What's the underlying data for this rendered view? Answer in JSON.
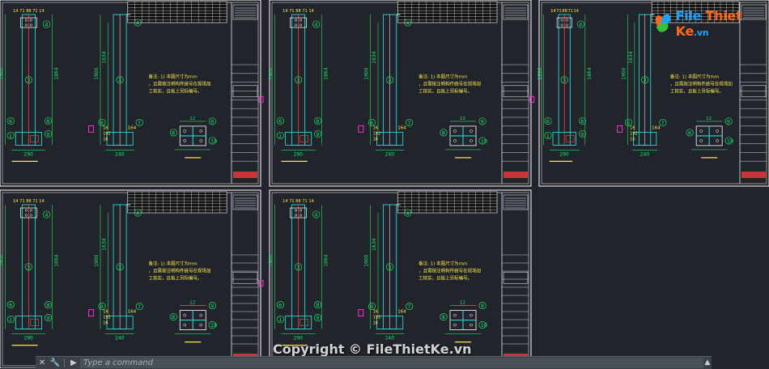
{
  "drawing": {
    "column_width": "290",
    "base_width": "240",
    "height_total": "1900",
    "height_inner": "1864",
    "height_side": "1634",
    "top_dims": [
      "14",
      "71",
      "88",
      "71",
      "14"
    ],
    "plate_size": "164",
    "base_small": [
      "16",
      "192",
      "16"
    ],
    "balloons": [
      "1",
      "2",
      "3",
      "4",
      "5",
      "6",
      "7",
      "8",
      "9",
      "10",
      "12"
    ],
    "note": "备注: 1) 本图尺寸为mm，且需按注明构件统号在现场加工核实，且板上另标编号。"
  },
  "watermark": {
    "logo_main": "File",
    "logo_second": "Thiet",
    "logo_third": "Ke",
    "logo_suffix": ".vn",
    "copyright": "Copyright © FileThietKe.vn"
  },
  "command_line": {
    "close_glyph": "✕",
    "settings_glyph": "🔧",
    "prompt_glyph": "▶",
    "placeholder": "Type a command",
    "dropdown_glyph": "▲"
  },
  "colors": {
    "background": "#21252b",
    "frame": "#ffffff",
    "dimension": "#22e06a",
    "steel": "#2ad3d3",
    "red_line": "#e03a3a",
    "magenta": "#ff2cd5",
    "yellow": "#ffe74a"
  }
}
